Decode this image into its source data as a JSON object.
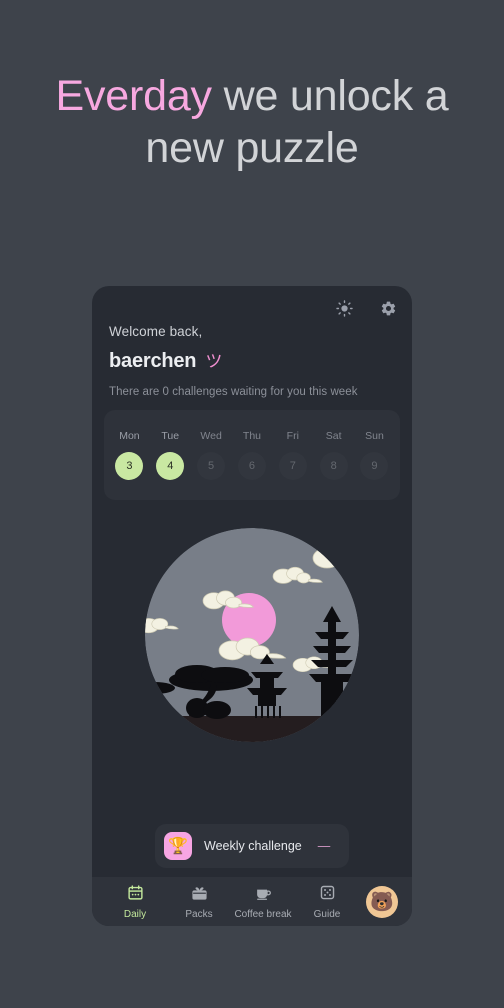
{
  "headline": {
    "accent_word": "Everday",
    "rest": " we unlock a new puzzle",
    "accent_color": "#f7a8e0"
  },
  "card": {
    "topbar": {
      "brightness_icon": "sun-icon",
      "settings_icon": "gear-icon"
    },
    "greeting": {
      "hello": "Welcome back,",
      "username": "baerchen",
      "kaomoji": "ツ",
      "subtitle": "There are 0 challenges waiting for you this week"
    },
    "week": {
      "days": [
        {
          "label": "Mon",
          "number": "3",
          "active": true
        },
        {
          "label": "Tue",
          "number": "4",
          "active": true
        },
        {
          "label": "Wed",
          "number": "5",
          "active": false
        },
        {
          "label": "Thu",
          "number": "6",
          "active": false
        },
        {
          "label": "Fri",
          "number": "7",
          "active": false
        },
        {
          "label": "Sat",
          "number": "8",
          "active": false
        },
        {
          "label": "Sun",
          "number": "9",
          "active": false
        }
      ],
      "active_color": "#c9e8a2"
    },
    "illustration": {
      "name": "japanese-night-scene",
      "sky_color": "#787e88",
      "moon_color": "#f29ad9",
      "cloud_color": "#f3f1e2",
      "silhouette_color": "#0d0d10",
      "ground_color": "#241d1f"
    },
    "weekly_challenge": {
      "icon": "trophy-icon",
      "emoji": "🏆",
      "label": "Weekly challenge",
      "value": "—",
      "badge_color": "#f7a5e3"
    },
    "nav": {
      "items": [
        {
          "label": "Daily",
          "icon": "calendar-icon",
          "active": true
        },
        {
          "label": "Packs",
          "icon": "gift-box-icon",
          "active": false
        },
        {
          "label": "Coffee break",
          "icon": "coffee-cup-icon",
          "active": false
        },
        {
          "label": "Guide",
          "icon": "dice-icon",
          "active": false
        }
      ],
      "avatar": {
        "icon": "bear-avatar",
        "emoji": "🐻"
      },
      "active_color": "#c3e89c"
    }
  }
}
